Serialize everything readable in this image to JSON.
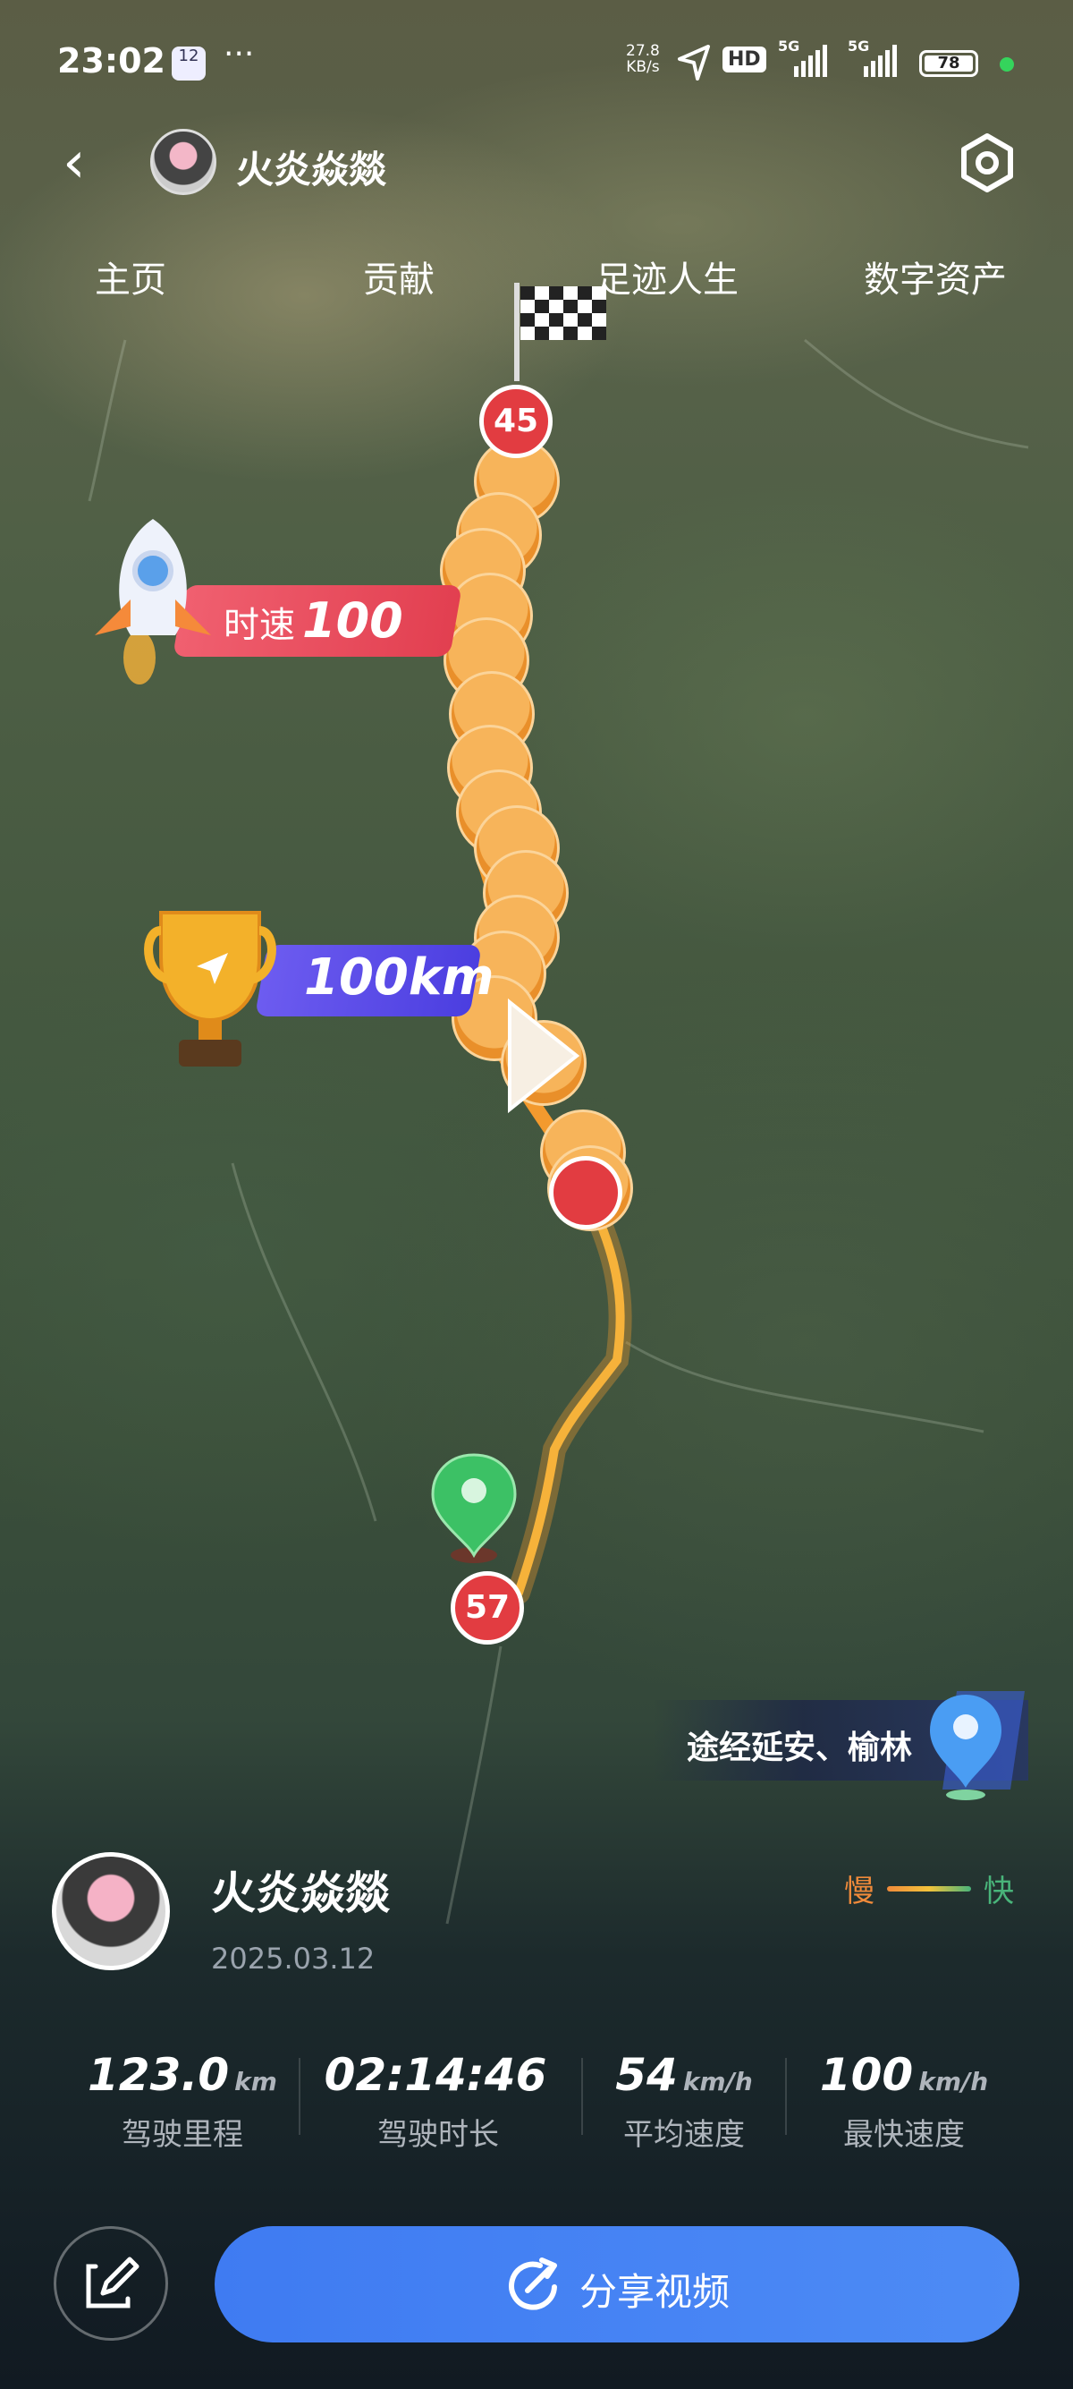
{
  "status_bar": {
    "time": "23:02",
    "calendar_day": "12",
    "more": "···",
    "net_speed_value": "27.8",
    "net_speed_unit": "KB/s",
    "hd": "HD",
    "sig1_label": "5G",
    "sig2_label": "5G",
    "battery": "78"
  },
  "header": {
    "back": "‹",
    "username": "火炎焱燚"
  },
  "tabs": [
    "主页",
    "贡献",
    "足迹人生",
    "数字资产"
  ],
  "map": {
    "finish_badge": "45",
    "start_badge": "57",
    "speed_tag_label": "时速",
    "speed_tag_value": "100",
    "distance_tag": "100km",
    "via_text": "途经延安、榆林"
  },
  "trip": {
    "username": "火炎焱燚",
    "date": "2025.03.12",
    "legend_slow": "慢",
    "legend_fast": "快",
    "stats": [
      {
        "value": "123.0",
        "unit": "km",
        "label": "驾驶里程"
      },
      {
        "value": "02:14:46",
        "unit": "",
        "label": "驾驶时长"
      },
      {
        "value": "54",
        "unit": "km/h",
        "label": "平均速度"
      },
      {
        "value": "100",
        "unit": "km/h",
        "label": "最快速度"
      }
    ],
    "share_label": "分享视频"
  },
  "colors": {
    "accent_blue": "#3f7bf2",
    "badge_red": "#e23c41",
    "route_orange": "#f39a2e",
    "legend_slow": "#f08a3a",
    "legend_fast": "#49b47a"
  }
}
